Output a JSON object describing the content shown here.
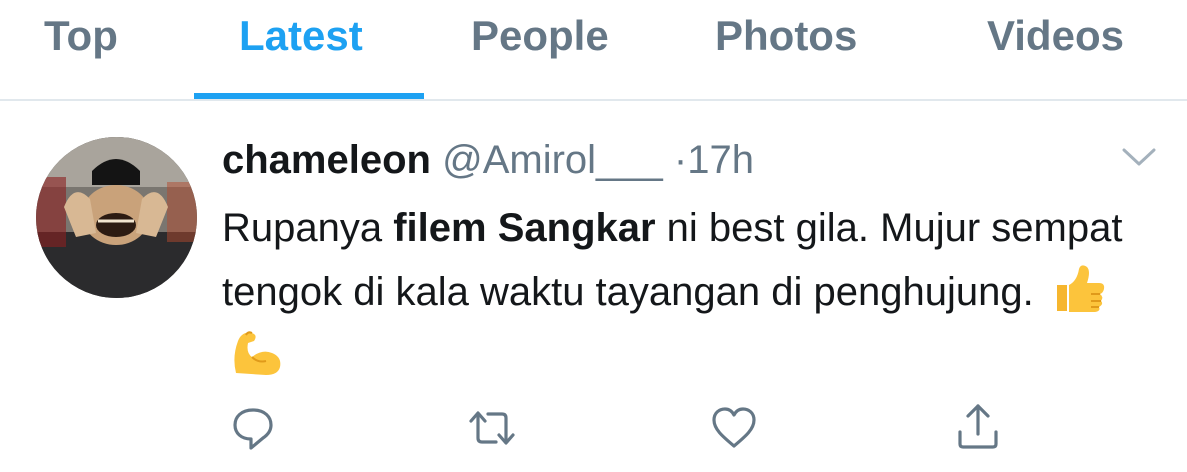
{
  "tabs": [
    {
      "label": "Top",
      "active": false
    },
    {
      "label": "Latest",
      "active": true
    },
    {
      "label": "People",
      "active": false
    },
    {
      "label": "Photos",
      "active": false
    },
    {
      "label": "Videos",
      "active": false
    }
  ],
  "tweet": {
    "display_name": "chameleon",
    "handle": "@Amirol___",
    "separator": "·",
    "timestamp": "17h",
    "text_part1": "Rupanya ",
    "text_bold": "filem Sangkar",
    "text_part2": " ni best gila. Mujur sempat tengok di kala waktu tayangan di penghujung. ",
    "emojis": [
      "thumbs-up-emoji",
      "flexed-biceps-emoji"
    ],
    "actions": [
      "reply-icon",
      "retweet-icon",
      "like-icon",
      "share-icon"
    ]
  },
  "colors": {
    "accent": "#1da1f2",
    "secondary_text": "#657786",
    "primary_text": "#14171a",
    "divider": "#e1e8ed"
  }
}
